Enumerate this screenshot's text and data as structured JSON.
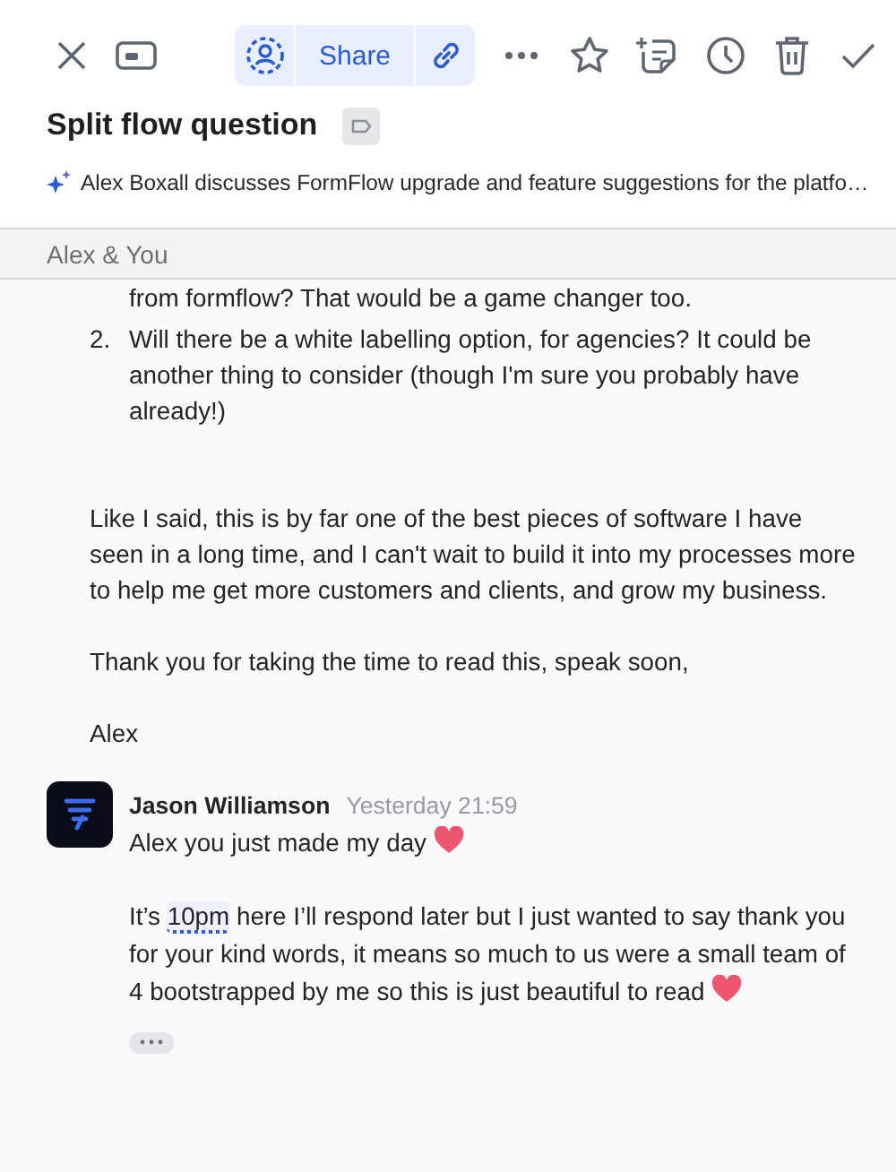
{
  "toolbar": {
    "share": {
      "label": "Share"
    }
  },
  "thread": {
    "title": "Split flow question",
    "summary": "Alex Boxall discusses FormFlow upgrade and feature suggestions for the platfo…"
  },
  "conversation": {
    "participants": "Alex & You"
  },
  "messages": [
    {
      "kind": "continuation",
      "list": [
        {
          "text": "from formflow? That would be a game changer too."
        },
        {
          "number": "2.",
          "text": "Will there be a white labelling option, for agencies? It could be another thing to consider (though I'm sure you probably have already!)"
        }
      ],
      "paragraphs": [
        {
          "text": "Like I said, this is by far one of the best pieces of software I have seen in a long time, and I can't wait to build it into my processes more to help me get more customers and clients, and grow my business."
        },
        {
          "text": "Thank you for taking the time to read this, speak soon,"
        },
        {
          "text": "Alex"
        }
      ]
    },
    {
      "kind": "message",
      "sender": "Jason Williamson",
      "time": "Yesterday 21:59",
      "paragraphs": [
        {
          "segments": [
            {
              "text": "Alex you just made my day "
            }
          ],
          "heart": true
        },
        {
          "segments": [
            {
              "text": "It’s "
            },
            {
              "text": "10pm",
              "kind": "detected-time"
            },
            {
              "text": " here I’ll respond later but I just wanted to say thank you for your kind words, it means so much to us were a small team of 4 bootstrapped by me so this is just beautiful to read "
            }
          ],
          "heart": true
        }
      ],
      "collapsed_quote": true
    }
  ]
}
